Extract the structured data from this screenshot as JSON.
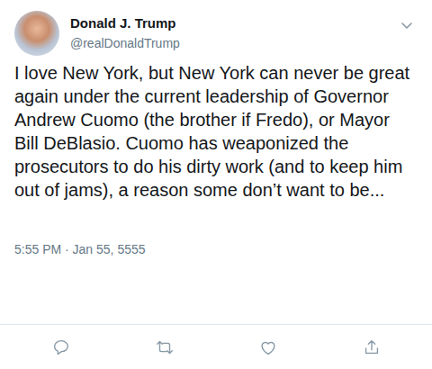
{
  "tweet": {
    "author": {
      "name": "Donald J. Trump",
      "handle": "@realDonaldTrump"
    },
    "text": "I love New York, but New York can never be great again under the current leadership of Governor Andrew Cuomo (the brother if Fredo), or Mayor Bill DeBlasio. Cuomo has weaponized the prosecutors to do his dirty work (and to keep him out of jams), a reason some don’t want to be...",
    "timestamp": "5:55 PM · Jan 55, 5555"
  }
}
